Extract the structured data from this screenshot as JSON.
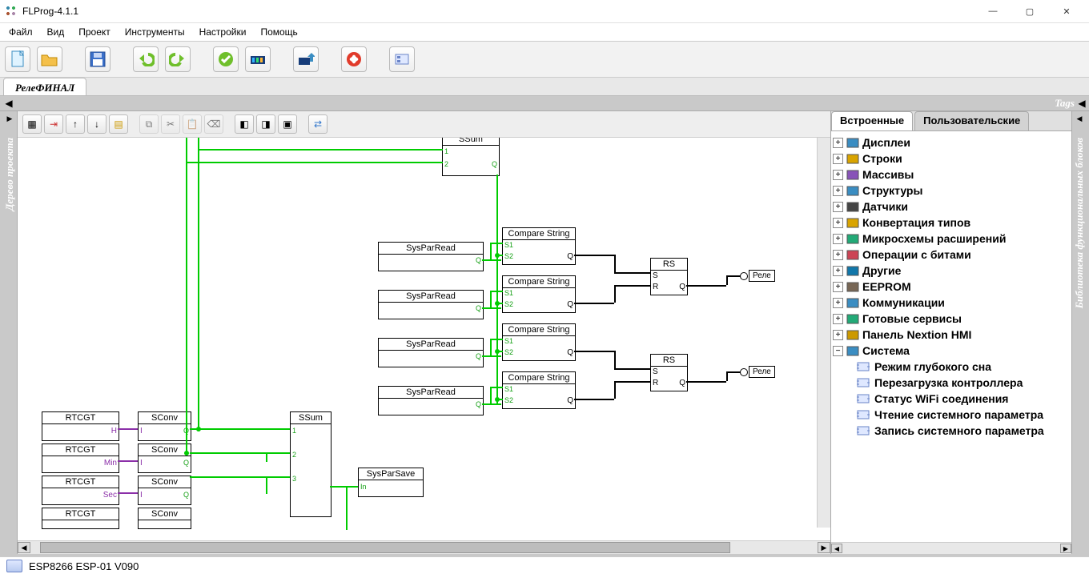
{
  "window": {
    "title": "FLProg-4.1.1"
  },
  "menu": [
    "Файл",
    "Вид",
    "Проект",
    "Инструменты",
    "Настройки",
    "Помощь"
  ],
  "doc_tab": "РелеФИНАЛ",
  "ruler": {
    "tags": "Tags"
  },
  "left_panel_label": "Дерево проекта",
  "right_panel_label": "Библиотека функциональных блоков",
  "diagram": {
    "blocks": {
      "ssum_top": "SSum",
      "syspar_read": "SysParRead",
      "compare_string": "Compare String",
      "rs": "RS",
      "rtcgt": "RTCGT",
      "sconv": "SConv",
      "ssum": "SSum",
      "syspar_save": "SysParSave",
      "rele": "Реле"
    },
    "ports": {
      "q": "Q",
      "i": "I",
      "in": "In",
      "s1": "S1",
      "s2": "S2",
      "s": "S",
      "r": "R",
      "h": "H",
      "min": "Min",
      "sec": "Sec",
      "n1": "1",
      "n2": "2",
      "n3": "3"
    }
  },
  "library": {
    "tabs": {
      "builtin": "Встроенные",
      "user": "Пользовательские"
    },
    "nodes": [
      {
        "exp": "+",
        "label": "Дисплеи"
      },
      {
        "exp": "+",
        "label": "Строки"
      },
      {
        "exp": "+",
        "label": "Массивы"
      },
      {
        "exp": "+",
        "label": "Структуры"
      },
      {
        "exp": "+",
        "label": "Датчики"
      },
      {
        "exp": "+",
        "label": "Конвертация типов"
      },
      {
        "exp": "+",
        "label": "Микросхемы расширений"
      },
      {
        "exp": "+",
        "label": "Операции с битами"
      },
      {
        "exp": "+",
        "label": "Другие"
      },
      {
        "exp": "+",
        "label": "EEPROM"
      },
      {
        "exp": "+",
        "label": "Коммуникации"
      },
      {
        "exp": "+",
        "label": "Готовые сервисы"
      },
      {
        "exp": "+",
        "label": "Панель Nextion HMI"
      },
      {
        "exp": "−",
        "label": "Система",
        "children": [
          "Режим глубокого сна",
          "Перезагрузка контроллера",
          "Статус WiFi соединения",
          "Чтение системного параметра",
          "Запись системного параметра"
        ]
      }
    ]
  },
  "statusbar": {
    "device": "ESP8266 ESP-01 V090"
  }
}
